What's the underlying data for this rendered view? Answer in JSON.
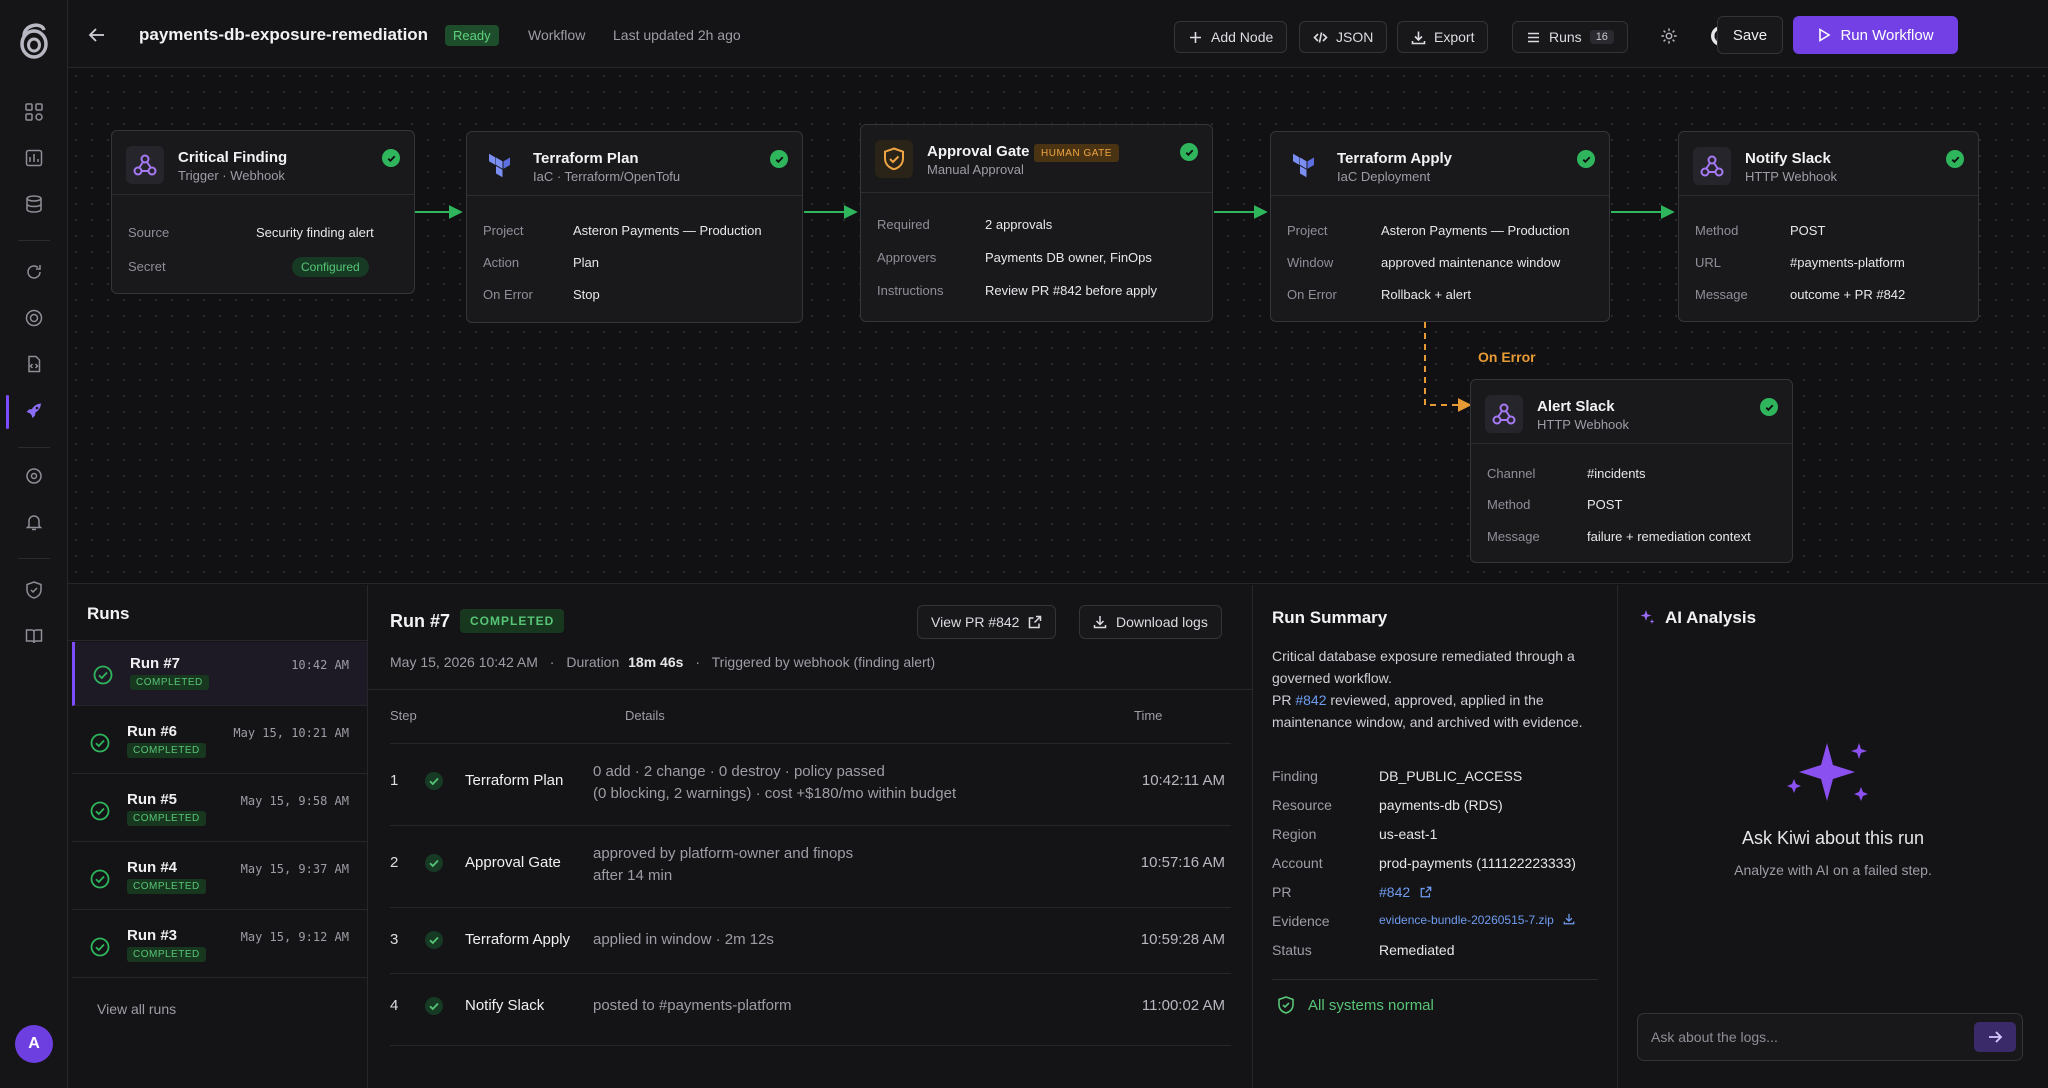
{
  "header": {
    "title": "payments-db-exposure-remediation",
    "status": "Ready",
    "type": "Workflow",
    "updated": "Last updated 2h ago",
    "add_node": "Add Node",
    "json": "JSON",
    "export": "Export",
    "runs": "Runs",
    "runs_count": "16",
    "save": "Save",
    "run_workflow": "Run Workflow"
  },
  "nodes": {
    "critical": {
      "title": "Critical Finding",
      "subtitle": "Trigger · Webhook",
      "k1": "Source",
      "v1": "Security finding alert",
      "k2": "Secret",
      "v2": "Configured"
    },
    "plan": {
      "title": "Terraform Plan",
      "subtitle": "IaC · Terraform/OpenTofu",
      "k1": "Project",
      "v1": "Asteron Payments — Production",
      "k2": "Action",
      "v2": "Plan",
      "k3": "On Error",
      "v3": "Stop"
    },
    "approval": {
      "title": "Approval Gate",
      "badge": "HUMAN GATE",
      "subtitle": "Manual Approval",
      "k1": "Required",
      "v1": "2 approvals",
      "k2": "Approvers",
      "v2": "Payments DB owner, FinOps",
      "k3": "Instructions",
      "v3": "Review PR #842 before apply"
    },
    "apply": {
      "title": "Terraform Apply",
      "subtitle": "IaC Deployment",
      "k1": "Project",
      "v1": "Asteron Payments — Production",
      "k2": "Window",
      "v2": "approved maintenance window",
      "k3": "On Error",
      "v3": "Rollback + alert"
    },
    "notify": {
      "title": "Notify Slack",
      "subtitle": "HTTP Webhook",
      "k1": "Method",
      "v1": "POST",
      "k2": "URL",
      "v2": "#payments-platform",
      "k3": "Message",
      "v3": "outcome + PR #842"
    },
    "alert": {
      "title": "Alert Slack",
      "subtitle": "HTTP Webhook",
      "k1": "Channel",
      "v1": "#incidents",
      "k2": "Method",
      "v2": "POST",
      "k3": "Message",
      "v3": "failure + remediation context"
    },
    "on_error_label": "On Error"
  },
  "runs": {
    "title": "Runs",
    "items": [
      {
        "name": "Run #7",
        "status": "COMPLETED",
        "time": "10:42 AM"
      },
      {
        "name": "Run #6",
        "status": "COMPLETED",
        "time": "May 15, 10:21 AM"
      },
      {
        "name": "Run #5",
        "status": "COMPLETED",
        "time": "May 15, 9:58 AM"
      },
      {
        "name": "Run #4",
        "status": "COMPLETED",
        "time": "May 15, 9:37 AM"
      },
      {
        "name": "Run #3",
        "status": "COMPLETED",
        "time": "May 15, 9:12 AM"
      }
    ],
    "view_all": "View all runs"
  },
  "detail": {
    "title": "Run #7",
    "status": "COMPLETED",
    "view_pr": "View PR #842",
    "download_logs": "Download logs",
    "date": "May 15, 2026 10:42 AM",
    "duration_label": "Duration",
    "duration": "18m 46s",
    "triggered": "Triggered by webhook (finding alert)",
    "col_step": "Step",
    "col_details": "Details",
    "col_time": "Time",
    "steps": [
      {
        "num": "1",
        "name": "Terraform Plan",
        "details1": "0 add  ·  2 change  ·  0 destroy  ·  policy passed",
        "details2": "(0 blocking, 2 warnings)  ·  cost +$180/mo within budget",
        "time": "10:42:11 AM"
      },
      {
        "num": "2",
        "name": "Approval Gate",
        "details1": "approved by platform-owner and finops",
        "details2": "after 14 min",
        "time": "10:57:16 AM"
      },
      {
        "num": "3",
        "name": "Terraform Apply",
        "details1": "applied in window  ·  2m 12s",
        "details2": "",
        "time": "10:59:28 AM"
      },
      {
        "num": "4",
        "name": "Notify Slack",
        "details1": "posted to #payments-platform",
        "details2": "",
        "time": "11:00:02 AM"
      }
    ]
  },
  "summary": {
    "title": "Run Summary",
    "desc_a": "Critical database exposure remediated through a governed workflow.",
    "desc_pr_prefix": "PR ",
    "desc_pr_link": "#842",
    "desc_b": " reviewed, approved, applied in the maintenance window, and archived with evidence.",
    "rows": [
      {
        "k": "Finding",
        "v": "DB_PUBLIC_ACCESS"
      },
      {
        "k": "Resource",
        "v": "payments-db (RDS)"
      },
      {
        "k": "Region",
        "v": "us-east-1"
      },
      {
        "k": "Account",
        "v": "prod-payments (111122223333)"
      },
      {
        "k": "PR",
        "v": "#842"
      },
      {
        "k": "Evidence",
        "v": "evidence-bundle-20260515-7.zip"
      },
      {
        "k": "Status",
        "v": "Remediated"
      }
    ],
    "all_normal": "All systems normal"
  },
  "ai": {
    "title": "AI Analysis",
    "prompt_title": "Ask Kiwi about this run",
    "prompt_desc": "Analyze with AI on a failed step.",
    "placeholder": "Ask about the logs..."
  },
  "user": {
    "avatar": "A"
  },
  "colors": {
    "accent": "#7340e6",
    "success": "#2fb55c",
    "warning": "#e89a35",
    "link": "#6f9cf0"
  }
}
